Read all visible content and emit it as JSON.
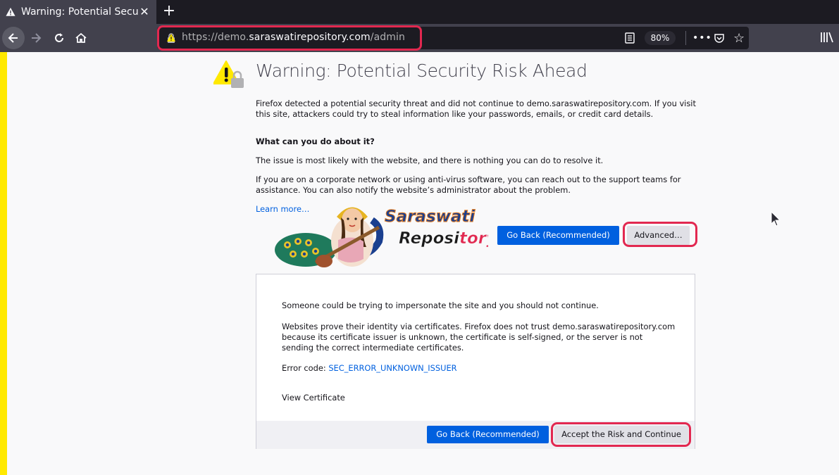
{
  "browser": {
    "tab_title": "Warning: Potential Security Risk Ahead",
    "tab_close": "✕",
    "new_tab": "+",
    "url_prefix": "https://demo.",
    "url_domain": "saraswatirepository.com",
    "url_path": "/admin",
    "zoom": "80%",
    "more": "•••",
    "star": "☆"
  },
  "page": {
    "title": "Warning: Potential Security Risk Ahead",
    "intro": "Firefox detected a potential security threat and did not continue to demo.saraswatirepository.com. If you visit this site, attackers could try to steal information like your passwords, emails, or credit card details.",
    "what_heading": "What can you do about it?",
    "issue": "The issue is most likely with the website, and there is nothing you can do to resolve it.",
    "corporate": "If you are on a corporate network or using anti-virus software, you can reach out to the support teams for assistance. You can also notify the website’s administrator about the problem.",
    "learn_more": "Learn more…",
    "go_back": "Go Back (Recommended)",
    "advanced": "Advanced…"
  },
  "advanced_panel": {
    "impersonate": "Someone could be trying to impersonate the site and you should not continue.",
    "certificates": "Websites prove their identity via certificates. Firefox does not trust demo.saraswatirepository.com because its certificate issuer is unknown, the certificate is self-signed, or the server is not sending the correct intermediate certificates.",
    "error_label": "Error code: ",
    "error_code": "SEC_ERROR_UNKNOWN_ISSUER",
    "view_certificate": "View Certificate",
    "go_back": "Go Back (Recommended)",
    "accept": "Accept the Risk and Continue"
  },
  "logo": {
    "line1": "Saraswati",
    "line2_a": "Reposi",
    "line2_b": "tory"
  },
  "colors": {
    "accent_blue": "#0060df",
    "highlight_red": "#e22850",
    "warning_yellow": "#ffe900"
  }
}
